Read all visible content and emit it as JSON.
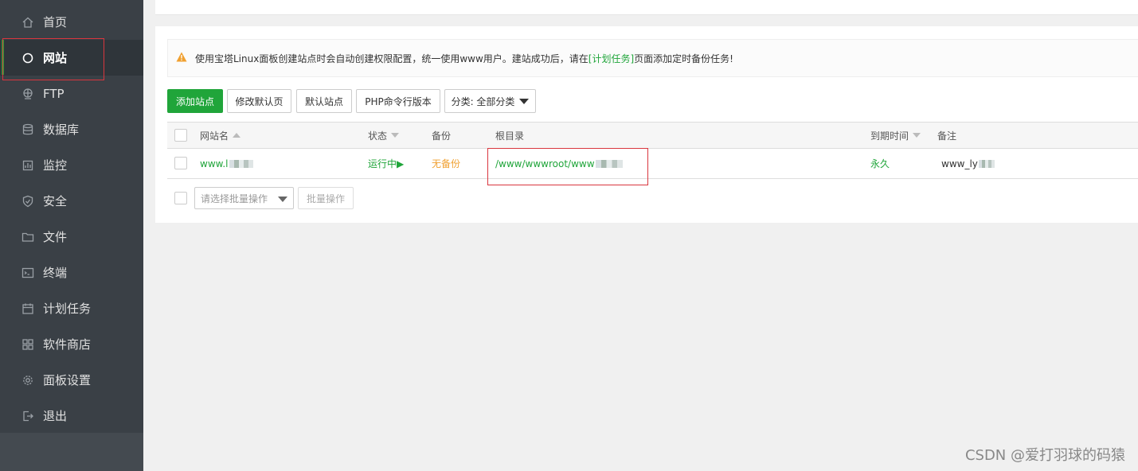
{
  "sidebar": {
    "items": [
      {
        "label": "首页",
        "icon": "home-icon"
      },
      {
        "label": "网站",
        "icon": "globe-icon",
        "active": true
      },
      {
        "label": "FTP",
        "icon": "ftp-icon"
      },
      {
        "label": "数据库",
        "icon": "database-icon"
      },
      {
        "label": "监控",
        "icon": "monitor-icon"
      },
      {
        "label": "安全",
        "icon": "shield-icon"
      },
      {
        "label": "文件",
        "icon": "folder-icon"
      },
      {
        "label": "终端",
        "icon": "terminal-icon"
      },
      {
        "label": "计划任务",
        "icon": "calendar-icon"
      },
      {
        "label": "软件商店",
        "icon": "grid-icon"
      },
      {
        "label": "面板设置",
        "icon": "gear-icon"
      },
      {
        "label": "退出",
        "icon": "logout-icon"
      }
    ]
  },
  "notice": {
    "text_before": "使用宝塔Linux面板创建站点时会自动创建权限配置，统一使用www用户。建站成功后，请在",
    "link": "[计划任务]",
    "text_after": "页面添加定时备份任务!"
  },
  "toolbar": {
    "add_site": "添加站点",
    "modify_default_page": "修改默认页",
    "default_site": "默认站点",
    "php_cli_version": "PHP命令行版本",
    "category": "分类: 全部分类"
  },
  "table": {
    "headers": {
      "name": "网站名",
      "status": "状态",
      "backup": "备份",
      "root": "根目录",
      "expire": "到期时间",
      "remark": "备注"
    },
    "rows": [
      {
        "name": "www.l",
        "status": "运行中▶",
        "backup": "无备份",
        "root": "/www/wwwroot/www",
        "expire": "永久",
        "remark": "www_ly"
      }
    ]
  },
  "bulk": {
    "select_placeholder": "请选择批量操作",
    "button": "批量操作"
  },
  "watermark": "CSDN @爱打羽球的码猿",
  "colors": {
    "sidebar_bg": "#3a4046",
    "accent_green": "#20a53a",
    "warning_orange": "#f0a030",
    "highlight_red": "#d9363e"
  }
}
